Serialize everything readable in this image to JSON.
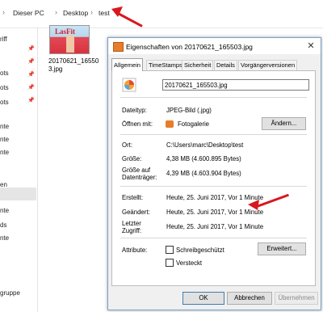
{
  "explorer": {
    "breadcrumb": [
      "Dieser PC",
      "Desktop",
      "test"
    ],
    "nav_items": [
      "riff",
      "ots",
      "ots",
      "ots",
      "nte",
      "nte",
      "nte",
      "en",
      "nte",
      "ds",
      "nte",
      "gruppe"
    ],
    "file_name": "20170621_165503.jpg",
    "file_name_display": "20170621_16550\n3.jpg",
    "thumbnail_text": "LasFit"
  },
  "dialog": {
    "title": "Eigenschaften von 20170621_165503.jpg",
    "close_glyph": "✕",
    "tabs": [
      "Allgemein",
      "TimeStamps",
      "Sicherheit",
      "Details",
      "Vorgängerversionen"
    ],
    "active_tab": "Allgemein",
    "filename_value": "20170621_165503.jpg",
    "dateityp_label": "Dateityp:",
    "dateityp_value": "JPEG-Bild (.jpg)",
    "oeffnen_label": "Öffnen mit:",
    "oeffnen_value": "Fotogalerie",
    "aendern_button": "Ändern...",
    "ort_label": "Ort:",
    "ort_value": "C:\\Users\\marc\\Desktop\\test",
    "groesse_label": "Größe:",
    "groesse_value": "4,38 MB (4.600.895 Bytes)",
    "groesse_auf_label_1": "Größe auf",
    "groesse_auf_label_2": "Datenträger:",
    "groesse_auf_value": "4,39 MB (4.603.904 Bytes)",
    "erstellt_label": "Erstellt:",
    "erstellt_value": "Heute, 25. Juni 2017, Vor 1 Minute",
    "geaendert_label": "Geändert:",
    "geaendert_value": "Heute, 25. Juni 2017, Vor 1 Minute",
    "letzter_label_1": "Letzter",
    "letzter_label_2": "Zugriff:",
    "letzter_value": "Heute, 25. Juni 2017, Vor 1 Minute",
    "attribute_label": "Attribute:",
    "schreib_label": "Schreibgeschützt",
    "versteckt_label": "Versteckt",
    "erweitert_button": "Erweitert...",
    "ok_button": "OK",
    "abbrechen_button": "Abbrechen",
    "uebernehmen_button": "Übernehmen"
  },
  "colors": {
    "accent_arrow": "#d9171e",
    "dialog_border": "#7a9ec9"
  }
}
